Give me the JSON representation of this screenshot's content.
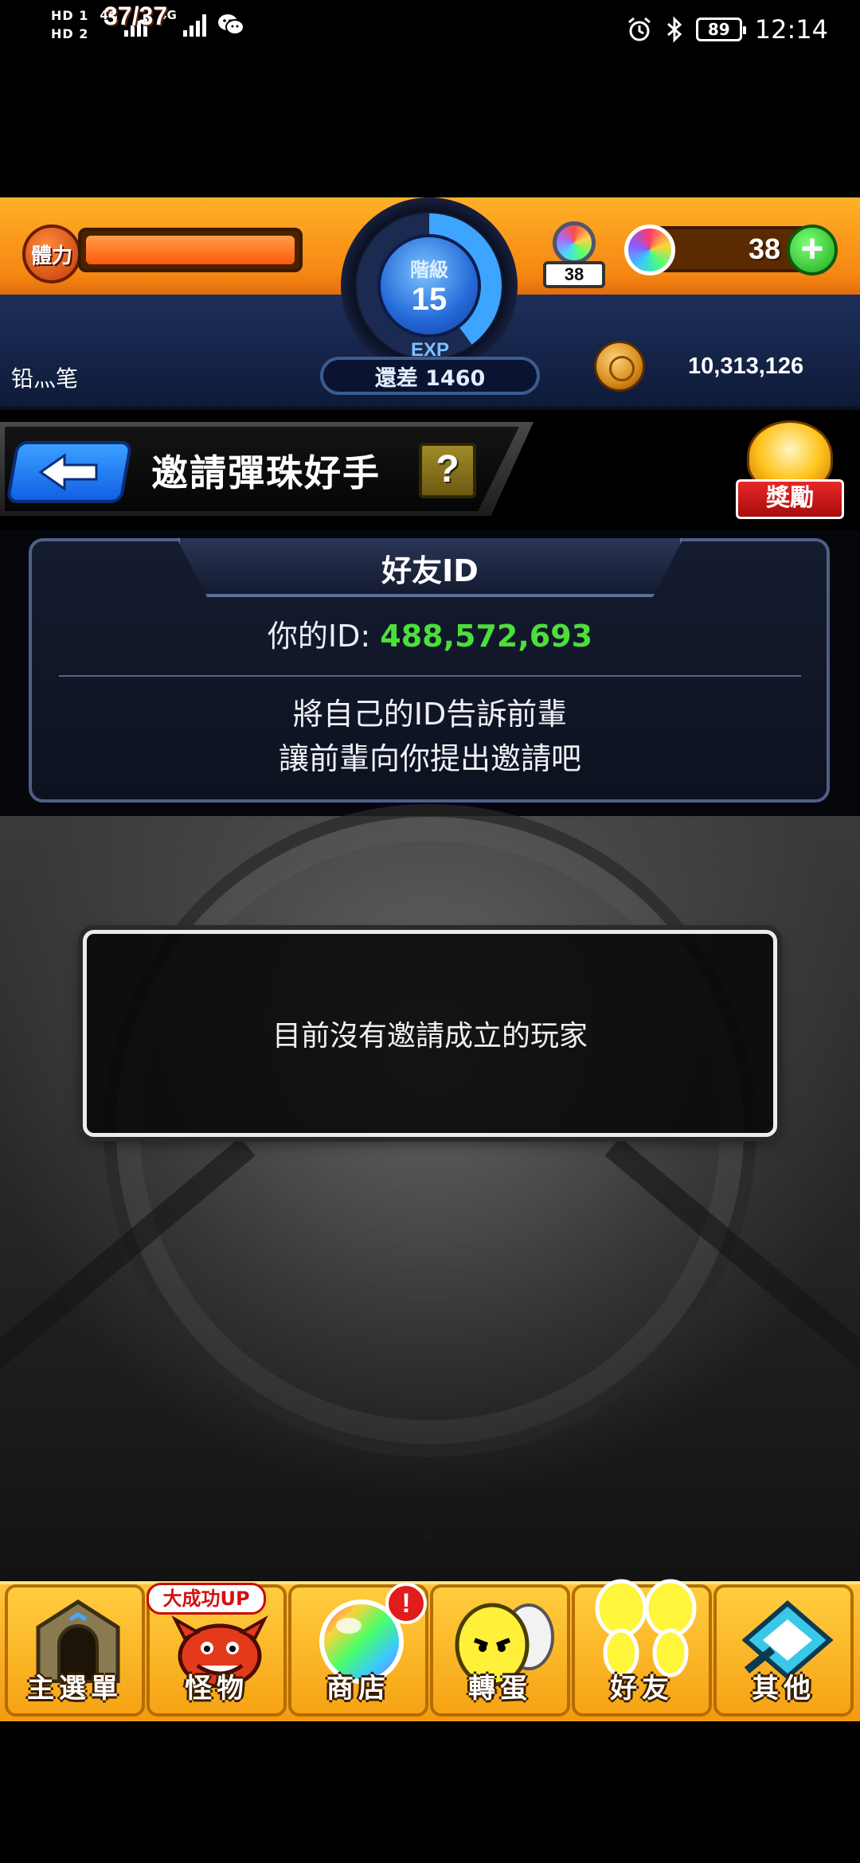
{
  "status_bar": {
    "sim1": "HD 1",
    "sim2": "HD 2",
    "network1": "4G",
    "network2": "4G",
    "battery": "89",
    "time": "12:14",
    "icons": [
      "signal-icon",
      "wechat-icon",
      "alarm-icon",
      "bluetooth-icon",
      "battery-icon"
    ]
  },
  "header": {
    "stamina_label": "體力",
    "stamina_value": "37/37",
    "stamina_fraction": 1.0,
    "rank_label": "階級",
    "rank_value": "15",
    "rank_progress": 0.4,
    "exp_label": "EXP",
    "exp_remaining": "還差 1460",
    "energy_count": "38",
    "gem_count": "38",
    "username": "铅灬笔",
    "gold": "10,313,126"
  },
  "title_bar": {
    "title": "邀請彈珠好手",
    "help": "?",
    "reward_label": "獎勵"
  },
  "friend_id_panel": {
    "title": "好友ID",
    "id_label": "你的ID:",
    "id_value": "488,572,693",
    "message_line1": "將自己的ID告訴前輩",
    "message_line2": "讓前輩向你提出邀請吧"
  },
  "empty_state": {
    "text": "目前沒有邀請成立的玩家"
  },
  "bottom_nav": {
    "items": [
      {
        "label": "主選單",
        "icon": "gate-icon"
      },
      {
        "label": "怪物",
        "icon": "monster-icon",
        "badge": "大成功UP"
      },
      {
        "label": "商店",
        "icon": "orb-icon",
        "badge": "!"
      },
      {
        "label": "轉蛋",
        "icon": "egg-icon"
      },
      {
        "label": "好友",
        "icon": "friends-icon"
      },
      {
        "label": "其他",
        "icon": "other-icon"
      }
    ]
  },
  "colors": {
    "accent_orange": "#f58612",
    "navy": "#1d2f5a",
    "id_green": "#4cdf3a",
    "nav_yellow": "#ffc43a"
  }
}
